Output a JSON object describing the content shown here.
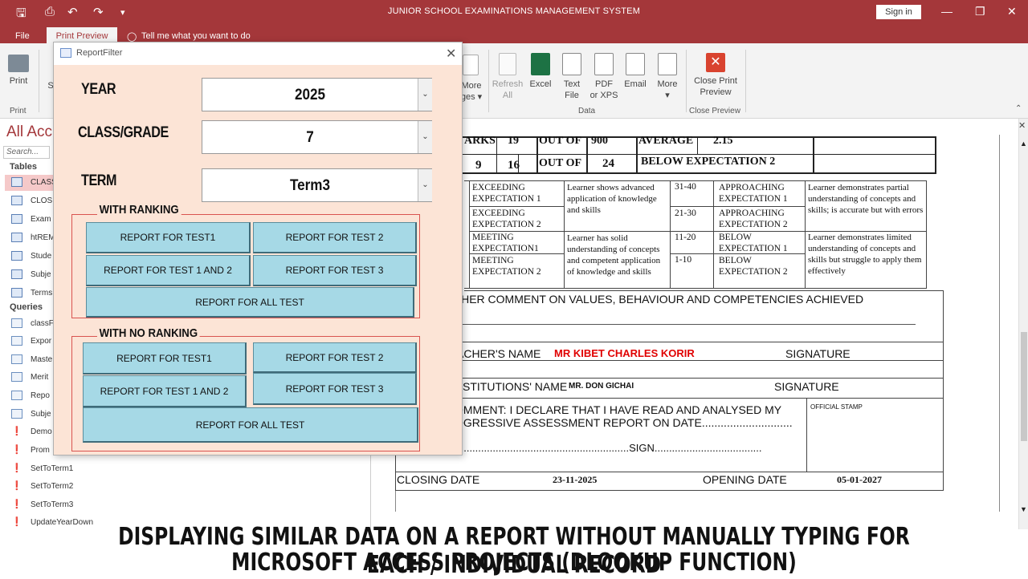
{
  "window": {
    "title": "JUNIOR SCHOOL EXAMINATIONS MANAGEMENT SYSTEM",
    "sign_in": "Sign in"
  },
  "tabs": {
    "file": "File",
    "print_preview": "Print Preview",
    "tell_me": "Tell me what you want to do"
  },
  "ribbon": {
    "print": "Print",
    "print_group": "Print",
    "s_partial": "S",
    "more_pages_1": "More",
    "more_pages_2": "ges",
    "refresh_1": "Refresh",
    "refresh_2": "All",
    "excel": "Excel",
    "text_file_1": "Text",
    "text_file_2": "File",
    "pdf_1": "PDF",
    "pdf_2": "or XPS",
    "email": "Email",
    "more": "More",
    "data_group": "Data",
    "close_preview_1": "Close Print",
    "close_preview_2": "Preview",
    "close_group": "Close Preview"
  },
  "nav": {
    "title": "All Acc",
    "search": "Search...",
    "tables_label": "Tables",
    "tables": [
      "CLASS",
      "CLOS",
      "Exam",
      "htREM",
      "Stude",
      "Subje",
      "Terms"
    ],
    "queries_label": "Queries",
    "queries": [
      "classF",
      "Expor",
      "Maste",
      "Merit",
      "Repo",
      "Subje"
    ],
    "macros": [
      "Demo",
      "Prom",
      "SetToTerm1",
      "SetToTerm2",
      "SetToTerm3",
      "UpdateYearDown"
    ]
  },
  "report": {
    "marks_lbl": "ARKS",
    "marks_val": "19",
    "out_of_1": "OUT OF",
    "out_of_val_1": "900",
    "average_lbl": "AVERAGE",
    "average_val": "2.15",
    "pos_a": "9",
    "pos_b": "16",
    "out_of_2": "OUT OF",
    "out_of_val_2": "24",
    "level": "BELOW EXPECTATION 2",
    "rubric": [
      {
        "level": "EXCEEDING EXPECTATION 1",
        "range": "31-40",
        "range_level": "APPROACHING EXPECTATION 1"
      },
      {
        "level": "EXCEEDING EXPECTATION 2",
        "range": "21-30",
        "range_level": "APPROACHING EXPECTATION 2"
      },
      {
        "level": "MEETING EXPECTATION1",
        "range": "11-20",
        "range_level": "BELOW EXPECTATION 1"
      },
      {
        "level": "MEETING EXPECTATION 2",
        "range": "1-10",
        "range_level": "BELOW EXPECTATION 2"
      }
    ],
    "desc_exceeding": "Learner shows advanced application of knowledge and skills",
    "desc_meeting": "Learner has solid understanding of concepts and competent application of knowledge and skills",
    "desc_approaching": "Learner demonstrates partial understanding of concepts and skills; is accurate but with errors",
    "desc_below": "Learner demonstrates limited understanding of concepts and skills but struggle to apply them effectively",
    "teacher_comment": "CHER COMMENT ON VALUES, BEHAVIOUR AND COMPETENCIES ACHIEVED",
    "teacher_name_lbl": "ACHER'S NAME",
    "teacher_name": "MR KIBET CHARLES KORIR",
    "signature_1": "SIGNATURE",
    "head_lbl": "STITUTIONS' NAME",
    "head_name": "MR. DON GICHAI",
    "signature_2": "SIGNATURE",
    "parent_comment_1": "OMMENT: I DECLARE THAT I HAVE READ AND ANALYSED MY",
    "parent_comment_2": "OGRESSIVE ASSESSMENT REPORT ON DATE.............................",
    "sign_line": "...........................................................SIGN.....................................",
    "official_stamp": "OFFICIAL STAMP",
    "closing_lbl": "CLOSING DATE",
    "closing_val": "23-11-2025",
    "opening_lbl": "OPENING DATE",
    "opening_val": "05-01-2027"
  },
  "dialog": {
    "title": "ReportFilter",
    "year_label": "YEAR",
    "year_value": "2025",
    "class_label": "CLASS/GRADE",
    "class_value": "7",
    "term_label": "TERM",
    "term_value": "Term3",
    "ranking_group": "WITH RANKING",
    "no_ranking_group": "WITH NO RANKING",
    "btn_test1": "REPORT FOR TEST1",
    "btn_test2": "REPORT FOR TEST  2",
    "btn_test12": "REPORT FOR TEST 1 AND 2",
    "btn_test3": "REPORT FOR TEST 3",
    "btn_all": "REPORT FOR ALL TEST"
  },
  "caption": {
    "line1": "DISPLAYING SIMILAR DATA ON A REPORT WITHOUT MANUALLY TYPING FOR EACH / INDIVIDUAL RECORD",
    "line2": "MICROSOFT ACCESS PROJECTS (DLOOKUP FUNCTION)"
  },
  "colors": {
    "brand": "#a4373a",
    "dialog_bg": "#fce4d6",
    "button": "#a6d9e6",
    "teacher_name": "#e00000"
  }
}
